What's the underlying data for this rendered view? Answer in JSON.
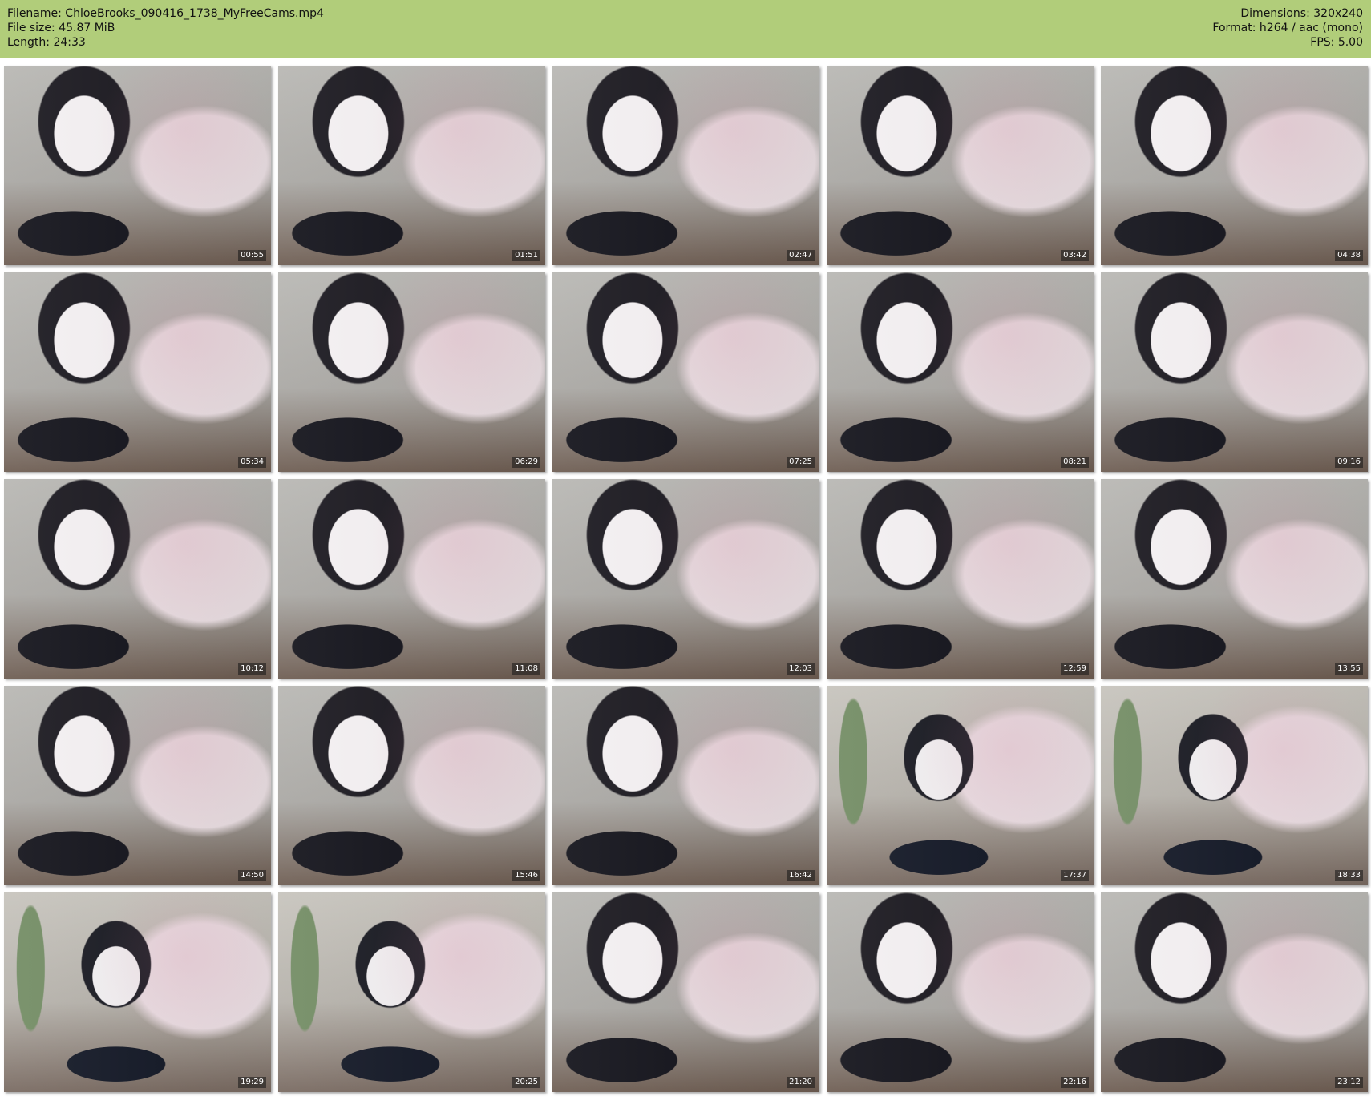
{
  "header": {
    "filename_label": "Filename: ChloeBrooks_090416_1738_MyFreeCams.mp4",
    "filesize_label": "File size: 45.87 MiB",
    "length_label": "Length: 24:33",
    "dimensions_label": "Dimensions: 320x240",
    "format_label": "Format: h264 / aac (mono)",
    "fps_label": "FPS: 5.00"
  },
  "thumbnails": [
    {
      "time": "00:55"
    },
    {
      "time": "01:51"
    },
    {
      "time": "02:47"
    },
    {
      "time": "03:42"
    },
    {
      "time": "04:38"
    },
    {
      "time": "05:34"
    },
    {
      "time": "06:29"
    },
    {
      "time": "07:25"
    },
    {
      "time": "08:21"
    },
    {
      "time": "09:16"
    },
    {
      "time": "10:12"
    },
    {
      "time": "11:08"
    },
    {
      "time": "12:03"
    },
    {
      "time": "12:59"
    },
    {
      "time": "13:55"
    },
    {
      "time": "14:50"
    },
    {
      "time": "15:46"
    },
    {
      "time": "16:42"
    },
    {
      "time": "17:37"
    },
    {
      "time": "18:33"
    },
    {
      "time": "19:29"
    },
    {
      "time": "20:25"
    },
    {
      "time": "21:20"
    },
    {
      "time": "22:16"
    },
    {
      "time": "23:12"
    }
  ],
  "colors": {
    "header_background": "#b1cd7a"
  }
}
